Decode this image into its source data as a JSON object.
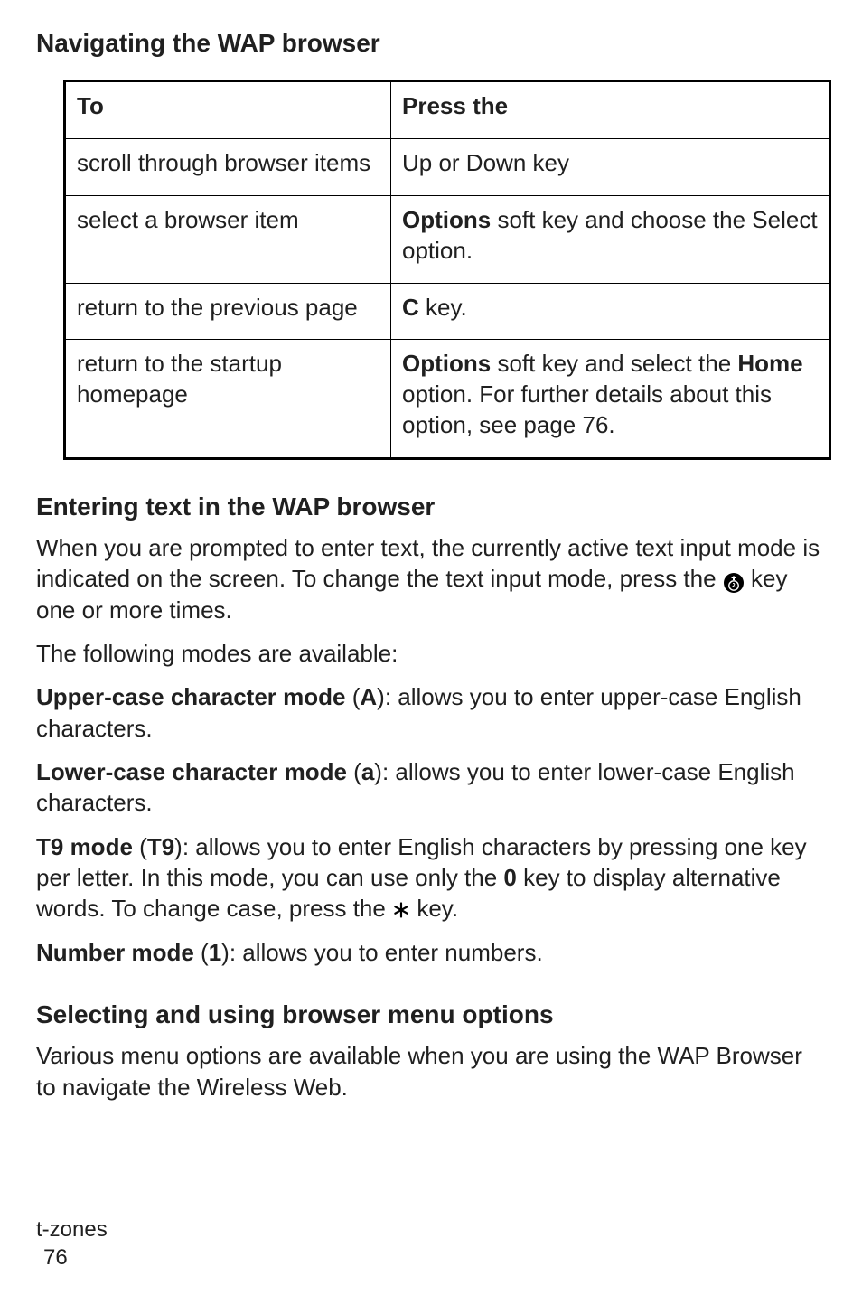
{
  "heading1": "Navigating the WAP browser",
  "table": {
    "header": {
      "col1": "To",
      "col2": "Press the"
    },
    "rows": [
      {
        "col1": "scroll through browser items",
        "col2": "Up or Down key"
      },
      {
        "col1": "select a browser item",
        "col2_bold1": "Options",
        "col2_rest": " soft key and choose the Select option."
      },
      {
        "col1": "return to the previous page",
        "col2_bold1": "C",
        "col2_rest": " key."
      },
      {
        "col1": "return to the startup homepage",
        "col2_bold1": "Options",
        "col2_mid1": " soft key and select the ",
        "col2_bold2": "Home",
        "col2_rest": " option. For further details about this option, see page 76."
      }
    ]
  },
  "heading2": "Entering text in the WAP browser",
  "para1_a": "When you are prompted to enter text, the currently active text input mode is indicated on the screen. To change the text input mode, press the ",
  "para1_b": " key one or more times.",
  "para2": "The following modes are available:",
  "upper_bold": "Upper-case character mode",
  "upper_paren_pre": " (",
  "upper_letter": "A",
  "upper_rest": "): allows you to enter upper-case English characters.",
  "lower_bold": "Lower-case character mode",
  "lower_paren_pre": " (",
  "lower_letter": "a",
  "lower_rest": "): allows you to enter lower-case English characters.",
  "t9_bold": "T9 mode",
  "t9_paren_pre": " (",
  "t9_letter": "T9",
  "t9_mid1": "): allows you to enter English characters by pressing one key per letter. In this mode, you can use only the ",
  "t9_zero": "0",
  "t9_mid2": " key to display alternative words. To change case, press the ",
  "t9_end": " key.",
  "num_bold": "Number mode",
  "num_paren_pre": " (",
  "num_letter": "1",
  "num_rest": "): allows you to enter numbers.",
  "heading3": "Selecting and using browser menu options",
  "para3": "Various menu options are available when you are using the WAP Browser to navigate the Wireless Web.",
  "footer_section": "t-zones",
  "footer_page": "76"
}
